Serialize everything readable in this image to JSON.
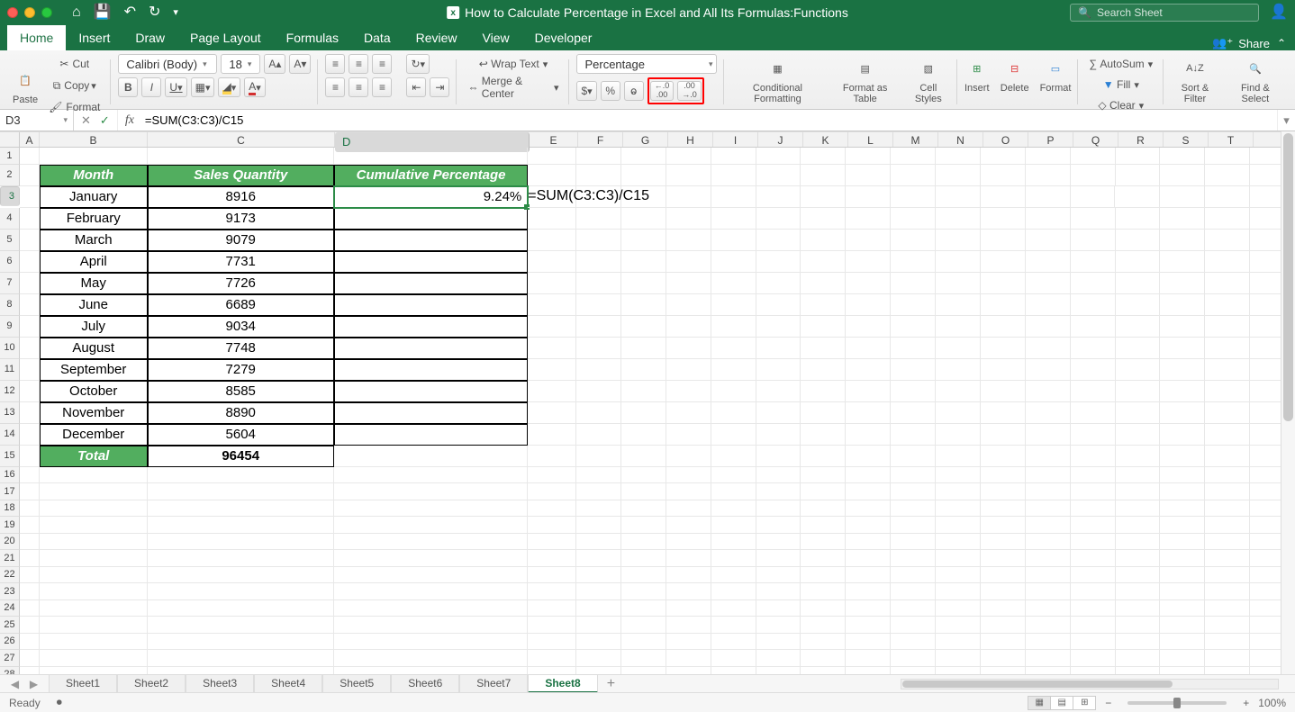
{
  "window": {
    "title": "How to Calculate Percentage in Excel and All Its Formulas:Functions",
    "search_placeholder": "Search Sheet"
  },
  "tabs": {
    "items": [
      "Home",
      "Insert",
      "Draw",
      "Page Layout",
      "Formulas",
      "Data",
      "Review",
      "View",
      "Developer"
    ],
    "active": "Home",
    "share": "Share"
  },
  "ribbon": {
    "paste": "Paste",
    "cut": "Cut",
    "copy": "Copy",
    "format_painter": "Format",
    "font_name": "Calibri (Body)",
    "font_size": "18",
    "wrap": "Wrap Text",
    "merge": "Merge & Center",
    "numfmt": "Percentage",
    "cond": "Conditional Formatting",
    "fmt_table": "Format as Table",
    "cell_styles": "Cell Styles",
    "insert": "Insert",
    "delete": "Delete",
    "format": "Format",
    "autosum": "AutoSum",
    "fill": "Fill",
    "clear": "Clear",
    "sortfilter": "Sort & Filter",
    "findselect": "Find & Select",
    "bold": "B",
    "italic": "I",
    "underline": "U",
    "inc_dec_hint": ".0",
    "inc_dec_hint2": ".00"
  },
  "formula_bar": {
    "name_box": "D3",
    "formula": "=SUM(C3:C3)/C15"
  },
  "columns": [
    "A",
    "B",
    "C",
    "D",
    "E",
    "F",
    "G",
    "H",
    "I",
    "J",
    "K",
    "L",
    "M",
    "N",
    "O",
    "P",
    "Q",
    "R",
    "S",
    "T"
  ],
  "sheet": {
    "header": {
      "b": "Month",
      "c": "Sales Quantity",
      "d": "Cumulative Percentage"
    },
    "rows": [
      {
        "month": "January",
        "qty": "8916",
        "pct": "9.24%"
      },
      {
        "month": "February",
        "qty": "9173",
        "pct": ""
      },
      {
        "month": "March",
        "qty": "9079",
        "pct": ""
      },
      {
        "month": "April",
        "qty": "7731",
        "pct": ""
      },
      {
        "month": "May",
        "qty": "7726",
        "pct": ""
      },
      {
        "month": "June",
        "qty": "6689",
        "pct": ""
      },
      {
        "month": "July",
        "qty": "9034",
        "pct": ""
      },
      {
        "month": "August",
        "qty": "7748",
        "pct": ""
      },
      {
        "month": "September",
        "qty": "7279",
        "pct": ""
      },
      {
        "month": "October",
        "qty": "8585",
        "pct": ""
      },
      {
        "month": "November",
        "qty": "8890",
        "pct": ""
      },
      {
        "month": "December",
        "qty": "5604",
        "pct": ""
      }
    ],
    "total_label": "Total",
    "total_value": "96454",
    "overflow_formula": "=SUM(C3:C3)/C15"
  },
  "sheet_tabs": {
    "items": [
      "Sheet1",
      "Sheet2",
      "Sheet3",
      "Sheet4",
      "Sheet5",
      "Sheet6",
      "Sheet7",
      "Sheet8"
    ],
    "active": "Sheet8"
  },
  "status": {
    "ready": "Ready",
    "zoom": "100%"
  }
}
